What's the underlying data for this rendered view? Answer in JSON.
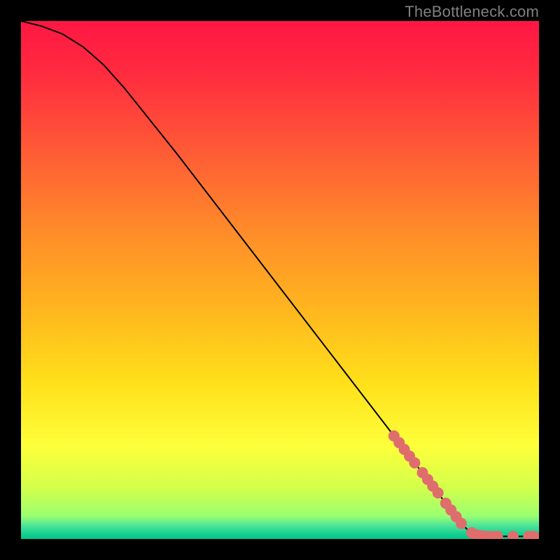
{
  "watermark": "TheBottleneck.com",
  "chart_data": {
    "type": "line",
    "xlim": [
      0,
      100
    ],
    "ylim": [
      0,
      100
    ],
    "title": "",
    "xlabel": "",
    "ylabel": "",
    "curve": [
      {
        "x": 0,
        "y": 100
      },
      {
        "x": 4,
        "y": 99
      },
      {
        "x": 8,
        "y": 97.5
      },
      {
        "x": 12,
        "y": 95
      },
      {
        "x": 16,
        "y": 91.5
      },
      {
        "x": 20,
        "y": 87
      },
      {
        "x": 30,
        "y": 74.5
      },
      {
        "x": 40,
        "y": 61.5
      },
      {
        "x": 50,
        "y": 48.5
      },
      {
        "x": 60,
        "y": 35.5
      },
      {
        "x": 70,
        "y": 22.5
      },
      {
        "x": 80,
        "y": 9.5
      },
      {
        "x": 85,
        "y": 3
      },
      {
        "x": 87,
        "y": 1
      },
      {
        "x": 90,
        "y": 0.5
      },
      {
        "x": 100,
        "y": 0.5
      }
    ],
    "scatter": [
      {
        "x": 72,
        "y": 19.9
      },
      {
        "x": 73,
        "y": 18.6
      },
      {
        "x": 74,
        "y": 17.3
      },
      {
        "x": 75,
        "y": 16.0
      },
      {
        "x": 76,
        "y": 14.7
      },
      {
        "x": 77.5,
        "y": 12.8
      },
      {
        "x": 78.5,
        "y": 11.5
      },
      {
        "x": 79.5,
        "y": 10.2
      },
      {
        "x": 80.5,
        "y": 8.9
      },
      {
        "x": 82,
        "y": 6.9
      },
      {
        "x": 83,
        "y": 5.6
      },
      {
        "x": 84,
        "y": 4.3
      },
      {
        "x": 85,
        "y": 3.0
      },
      {
        "x": 87,
        "y": 1.2
      },
      {
        "x": 88,
        "y": 0.8
      },
      {
        "x": 89,
        "y": 0.6
      },
      {
        "x": 90,
        "y": 0.5
      },
      {
        "x": 91,
        "y": 0.5
      },
      {
        "x": 92,
        "y": 0.5
      },
      {
        "x": 95,
        "y": 0.5
      },
      {
        "x": 98,
        "y": 0.5
      },
      {
        "x": 99,
        "y": 0.5
      }
    ],
    "gradient_stops": [
      {
        "pos": 0.0,
        "color": "#ff1744"
      },
      {
        "pos": 0.1,
        "color": "#ff2b3f"
      },
      {
        "pos": 0.25,
        "color": "#ff5a36"
      },
      {
        "pos": 0.4,
        "color": "#ff8a2a"
      },
      {
        "pos": 0.55,
        "color": "#ffb41f"
      },
      {
        "pos": 0.7,
        "color": "#ffe01a"
      },
      {
        "pos": 0.82,
        "color": "#fdff3a"
      },
      {
        "pos": 0.9,
        "color": "#d4ff4a"
      },
      {
        "pos": 0.955,
        "color": "#9cff70"
      },
      {
        "pos": 0.975,
        "color": "#4be39a"
      },
      {
        "pos": 0.99,
        "color": "#16d190"
      },
      {
        "pos": 1.0,
        "color": "#00c389"
      }
    ],
    "marker_color": "#e06d6d",
    "marker_radius": 8
  }
}
